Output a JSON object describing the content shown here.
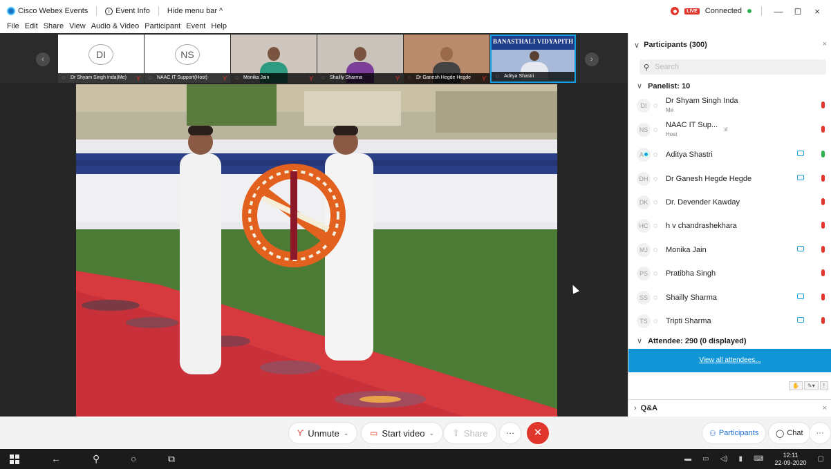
{
  "titlebar": {
    "app_name": "Cisco Webex Events",
    "event_info": "Event Info",
    "hide_menu": "Hide menu bar ^",
    "live": "LIVE",
    "connected": "Connected",
    "minimize": "—",
    "restore": "◻",
    "close": "×"
  },
  "menu": [
    "File",
    "Edit",
    "Share",
    "View",
    "Audio & Video",
    "Participant",
    "Event",
    "Help"
  ],
  "thumbnails": [
    {
      "initials": "DI",
      "label": "Dr Shyam Singh Inda(Me)"
    },
    {
      "initials": "NS",
      "label": "NAAC IT Support(Host)"
    },
    {
      "initials": "",
      "label": "Monika Jain"
    },
    {
      "initials": "",
      "label": "Shailly Sharma"
    },
    {
      "initials": "",
      "label": "Dr Ganesh Hegde Hegde"
    },
    {
      "initials": "",
      "label": "Aditya Shastri",
      "banner": "BANASTHALI VIDYAPITH"
    }
  ],
  "panel": {
    "title": "Participants (300)",
    "search_placeholder": "Search",
    "panelist_header": "Panelist: 10",
    "attendee_header": "Attendee: 290 (0 displayed)",
    "view_all": "View all attendees...",
    "qa_header": "Q&A",
    "signal": "⫶ıl",
    "panelists": [
      {
        "initials": "DI",
        "name": "Dr Shyam Singh Inda",
        "role": "Me",
        "camera": false,
        "mic": "muted"
      },
      {
        "initials": "NS",
        "name": "NAAC IT Sup...",
        "role": "Host",
        "camera": false,
        "mic": "muted"
      },
      {
        "initials": "AS",
        "name": "Aditya Shastri",
        "role": "",
        "camera": true,
        "mic": "on"
      },
      {
        "initials": "DH",
        "name": "Dr Ganesh Hegde Hegde",
        "role": "",
        "camera": true,
        "mic": "muted"
      },
      {
        "initials": "DK",
        "name": "Dr. Devender Kawday",
        "role": "",
        "camera": false,
        "mic": "muted"
      },
      {
        "initials": "HC",
        "name": "h v chandrashekhara",
        "role": "",
        "camera": false,
        "mic": "muted"
      },
      {
        "initials": "MJ",
        "name": "Monika Jain",
        "role": "",
        "camera": true,
        "mic": "muted"
      },
      {
        "initials": "PS",
        "name": "Pratibha Singh",
        "role": "",
        "camera": false,
        "mic": "muted"
      },
      {
        "initials": "SS",
        "name": "Shailly Sharma",
        "role": "",
        "camera": true,
        "mic": "muted"
      },
      {
        "initials": "TS",
        "name": "Tripti Sharma",
        "role": "",
        "camera": true,
        "mic": "muted"
      }
    ]
  },
  "controls": {
    "unmute": "Unmute",
    "start_video": "Start video",
    "share": "Share",
    "more": "···",
    "leave": "✕",
    "participants": "Participants",
    "chat": "Chat",
    "panel_more": "···"
  },
  "taskbar": {
    "time": "12:11",
    "date": "22-09-2020"
  },
  "colors": {
    "accent": "#1096d6",
    "leave_red": "#e0362c",
    "connected_green": "#2fb24b"
  }
}
